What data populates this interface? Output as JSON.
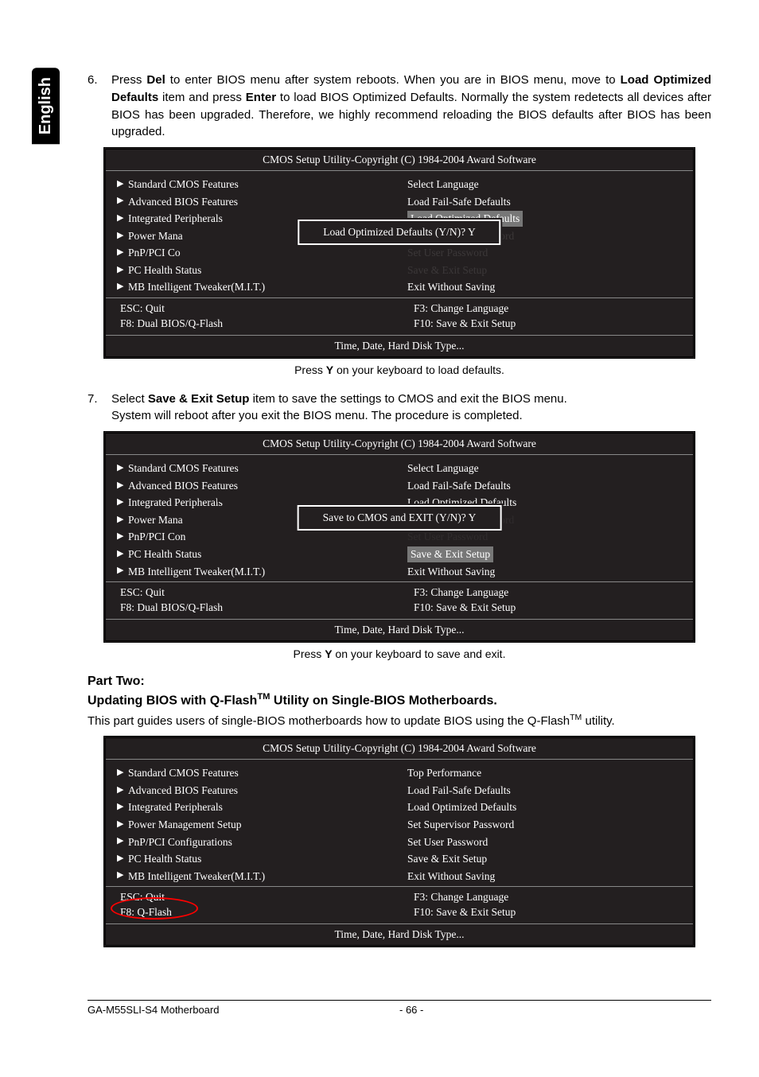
{
  "lang_tab": "English",
  "step6": {
    "num": "6.",
    "text_parts": [
      "Press ",
      "Del",
      " to enter BIOS menu after system reboots. When you are in BIOS menu, move to ",
      "Load Optimized Defaults",
      " item and press ",
      "Enter",
      " to load BIOS Optimized Defaults. Normally the system redetects all devices after BIOS has been upgraded. Therefore, we highly recommend reloading the BIOS defaults after BIOS has been upgraded."
    ]
  },
  "bios_title": "CMOS Setup Utility-Copyright (C) 1984-2004 Award Software",
  "bios_left_items": [
    "Standard CMOS Features",
    "Advanced BIOS Features",
    "Integrated Peripherals",
    "Power Management Setup",
    "PnP/PCI Configurations",
    "PC Health Status",
    "MB Intelligent Tweaker(M.I.T.)"
  ],
  "bios_left_items_trunc1": [
    "Standard CMOS Features",
    "Advanced BIOS Features",
    "Integrated Peripherals",
    "Power Mana",
    "PnP/PCI Co",
    "PC Health Status",
    "MB Intelligent Tweaker(M.I.T.)"
  ],
  "bios_left_items_trunc2": [
    "Standard CMOS Features",
    "Advanced BIOS Features",
    "Integrated Peripherals",
    "Power Mana",
    "PnP/PCI Con",
    "PC Health Status",
    "MB Intelligent Tweaker(M.I.T.)"
  ],
  "bios_right_items_1": [
    {
      "text": "Select Language",
      "hilite": false
    },
    {
      "text": "Load Fail-Safe Defaults",
      "hilite": false
    },
    {
      "text": "Load Optimized Defaults",
      "hilite": true
    },
    {
      "text": "Set Supervisor Password",
      "hilite": false
    },
    {
      "text": "Set User Password",
      "hilite": false
    },
    {
      "text": "Save & Exit Setup",
      "hilite": false
    },
    {
      "text": "Exit Without Saving",
      "hilite": false
    }
  ],
  "bios_right_items_2": [
    {
      "text": "Select Language",
      "hilite": false
    },
    {
      "text": "Load Fail-Safe Defaults",
      "hilite": false
    },
    {
      "text": "Load Optimized Defaults",
      "hilite": false
    },
    {
      "text": "Set Supervisor Password",
      "hilite": false
    },
    {
      "text": "Set User Password",
      "hilite": false
    },
    {
      "text": "Save & Exit Setup",
      "hilite": true
    },
    {
      "text": "Exit Without Saving",
      "hilite": false
    }
  ],
  "bios_right_items_3": [
    {
      "text": "Top Performance",
      "hilite": false
    },
    {
      "text": "Load Fail-Safe Defaults",
      "hilite": false
    },
    {
      "text": "Load Optimized Defaults",
      "hilite": false
    },
    {
      "text": "Set Supervisor Password",
      "hilite": false
    },
    {
      "text": "Set User Password",
      "hilite": false
    },
    {
      "text": "Save & Exit Setup",
      "hilite": false
    },
    {
      "text": "Exit Without Saving",
      "hilite": false
    }
  ],
  "bios_foot": {
    "l1": "ESC: Quit",
    "l2": "F8: Dual BIOS/Q-Flash",
    "r1": "F3: Change Language",
    "r2": "F10: Save & Exit Setup"
  },
  "bios_foot3": {
    "l1": "ESC: Quit",
    "l2": "F8: Q-Flash",
    "r1": "F3: Change Language",
    "r2": "F10: Save & Exit Setup"
  },
  "bios_help": "Time, Date, Hard Disk Type...",
  "popup1": "Load Optimized Defaults (Y/N)? Y",
  "popup2": "Save to CMOS and EXIT (Y/N)? Y",
  "caption1_parts": [
    "Press ",
    "Y",
    " on your keyboard to load defaults."
  ],
  "step7": {
    "num": "7.",
    "line1_parts": [
      "Select ",
      "Save & Exit Setup",
      " item to save the settings to CMOS and exit the BIOS menu."
    ],
    "line2": "System will reboot after you exit the BIOS menu. The procedure is completed."
  },
  "caption2_parts": [
    "Press ",
    "Y",
    " on your keyboard to save and exit."
  ],
  "part_two": "Part Two:",
  "subhead_parts": [
    "Updating BIOS with Q-Flash",
    " Utility on Single-BIOS Motherboards."
  ],
  "intro_parts": [
    "This part guides users of single-BIOS motherboards how to update BIOS using the Q-Flash",
    " utility."
  ],
  "tm": "TM",
  "footer": {
    "left": "GA-M55SLI-S4 Motherboard",
    "center": "- 66 -"
  }
}
